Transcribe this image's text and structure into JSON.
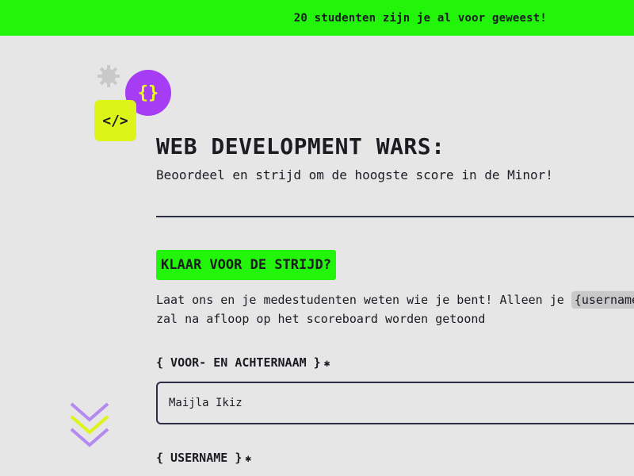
{
  "banner": {
    "text": "20 studenten zijn je al voor geweest!"
  },
  "logo": {
    "braces": "{}",
    "code": "</>"
  },
  "header": {
    "title": "WEB DEVELOPMENT WARS:",
    "subtitle": "Beoordeel en strijd om de hoogste score in de Minor!"
  },
  "section": {
    "cta": "KLAAR VOOR DE STRIJD?",
    "intro_line1_prefix": "Laat ons en je medestudenten weten wie je bent! Alleen je ",
    "intro_chip": "{username}",
    "intro_line2": "zal na afloop op het scoreboard worden getoond"
  },
  "form": {
    "name_label": "{ VOOR- EN ACHTERNAAM }",
    "name_value": "Maijla Ikiz",
    "username_label": "{ USERNAME }",
    "required_mark": "✱"
  },
  "colors": {
    "green": "#22f50a",
    "purple": "#a63cf3",
    "yellow": "#dcf417",
    "background": "#e6e6e6",
    "ink": "#1b1b22"
  },
  "icons": [
    "gear-icon",
    "braces-icon",
    "code-icon",
    "chevrons-down-icon"
  ]
}
